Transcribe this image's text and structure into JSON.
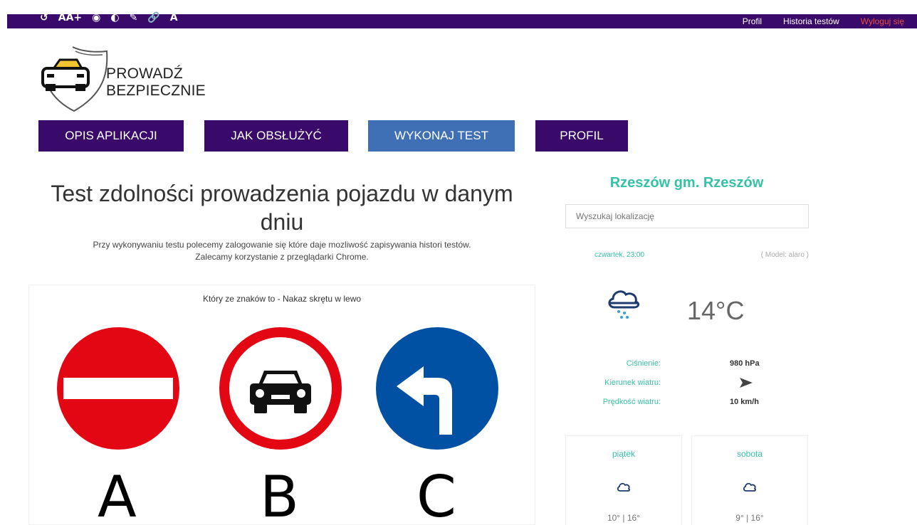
{
  "topbar": {
    "a11y_icons": [
      "reset-icon",
      "font-size-icon",
      "eye-icon",
      "contrast-icon",
      "hide-icon",
      "link-icon",
      "font-icon"
    ],
    "a11y_glyphs": [
      "↺",
      "AA+",
      "◉",
      "◐",
      "✎",
      "🔗",
      "A"
    ],
    "links": {
      "profile": "Profil",
      "history": "Historia testów",
      "logout": "Wyloguj się"
    }
  },
  "brand": {
    "line1": "PROWADŹ",
    "line2": "BEZPIECZNIE"
  },
  "nav": [
    "OPIS APLIKACJI",
    "JAK OBSŁUŻYĆ",
    "WYKONAJ TEST",
    "PROFIL"
  ],
  "main": {
    "title": "Test zdolności prowadzenia pojazdu w danym dniu",
    "sub1": "Przy wykonywaniu testu polecemy zalogowanie się które daje mozliwość zapisywania histori testów.",
    "sub2": "Zalecamy korzystanie z przeglądarki Chrome.",
    "question": "Który ze znaków to - Nakaz skrętu w lewo",
    "options": [
      "A",
      "B",
      "C"
    ]
  },
  "weather": {
    "location": "Rzeszów gm. Rzeszów",
    "search_placeholder": "Wyszukaj lokalizację",
    "date": "czwartek, 23:00",
    "model": "( Model: alaro )",
    "temp": "14°C",
    "pressure_label": "Ciśnienie:",
    "pressure_value": "980 hPa",
    "wind_dir_label": "Kierunek wiatru:",
    "wind_speed_label": "Prędkość wiatru:",
    "wind_speed_value": "10 km/h",
    "forecast": [
      {
        "day": "piątek",
        "temps": "10° | 16°"
      },
      {
        "day": "sobota",
        "temps": "9° | 16°"
      }
    ]
  },
  "colors": {
    "purple": "#3a0a6b",
    "active": "#3f6fb5",
    "teal": "#37c1a6",
    "red": "#e30613",
    "blue": "#0051a4"
  }
}
